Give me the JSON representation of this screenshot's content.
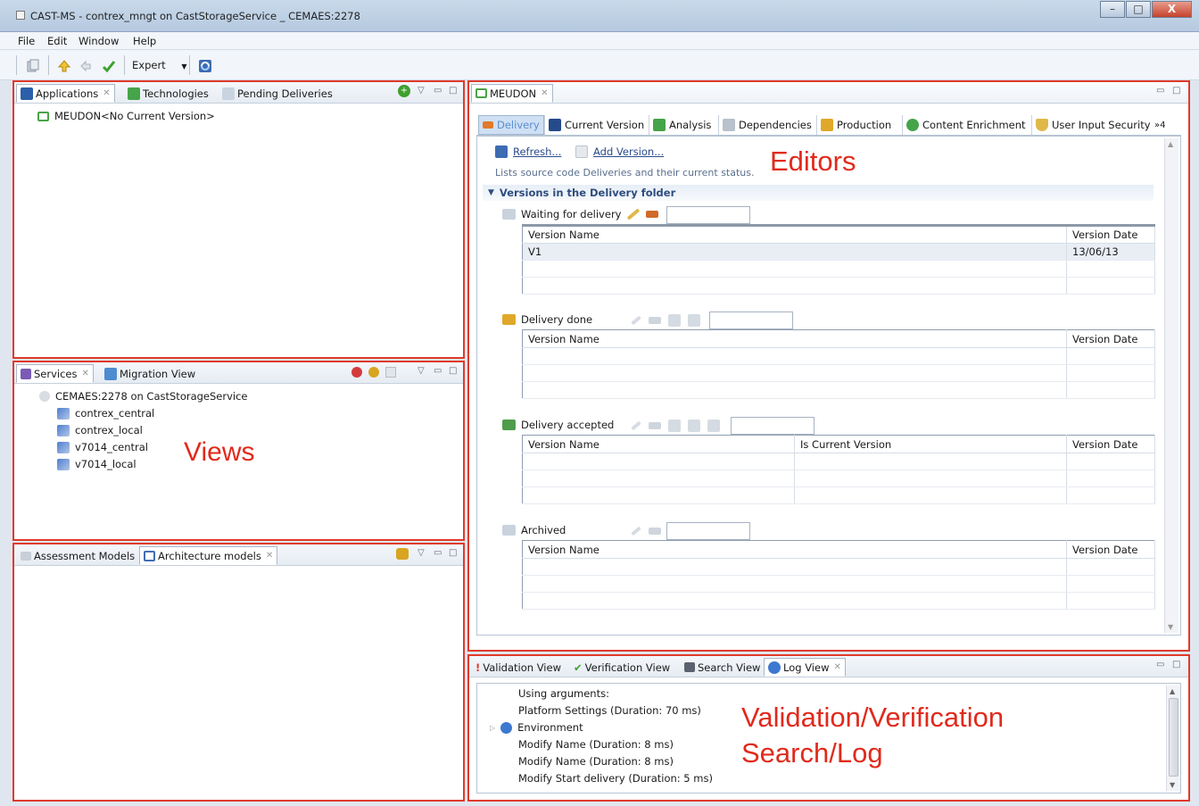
{
  "window": {
    "title": "CAST-MS - contrex_mngt on CastStorageService _ CEMAES:2278",
    "minimize": "–",
    "maximize": "□",
    "close": "X"
  },
  "menu": [
    "File",
    "Edit",
    "Window",
    "Help"
  ],
  "toolbar": {
    "mode": "Expert"
  },
  "top_left_panel": {
    "tabs": [
      {
        "label": "Applications",
        "icon": "application-icon"
      },
      {
        "label": "Technologies",
        "icon": "technology-icon"
      },
      {
        "label": "Pending Deliveries",
        "icon": "pending-deliveries-icon"
      }
    ],
    "tree": [
      {
        "label": "MEUDON<No Current Version>",
        "icon": "application-folder-icon"
      }
    ]
  },
  "mid_left_panel": {
    "tabs": [
      {
        "label": "Services",
        "icon": "services-icon"
      },
      {
        "label": "Migration View",
        "icon": "migration-icon"
      }
    ],
    "tree_root": "CEMAES:2278 on CastStorageService",
    "tree_children": [
      "contrex_central",
      "contrex_local",
      "v7014_central",
      "v7014_local"
    ]
  },
  "bottom_left_panel": {
    "tabs": [
      {
        "label": "Assessment Models",
        "icon": "assessment-icon"
      },
      {
        "label": "Architecture models",
        "icon": "architecture-icon"
      }
    ]
  },
  "overlays": {
    "views": "Views",
    "editors": "Editors",
    "validation_line1": "Validation/Verification",
    "validation_line2": "Search/Log"
  },
  "editor": {
    "tab": "MEUDON",
    "subtabs": [
      "Delivery",
      "Current Version",
      "Analysis",
      "Dependencies",
      "Production",
      "Content Enrichment",
      "User Input Security"
    ],
    "overflow": "»4",
    "refresh": "Refresh...",
    "add_version": "Add Version...",
    "description": "Lists source code Deliveries and their current status.",
    "section": "Versions in the Delivery folder",
    "groups": {
      "waiting": {
        "label": "Waiting for delivery",
        "columns": [
          "Version Name",
          "Version Date"
        ],
        "rows": [
          [
            "V1",
            "13/06/13"
          ]
        ]
      },
      "done": {
        "label": "Delivery done",
        "columns": [
          "Version Name",
          "Version Date"
        ]
      },
      "accepted": {
        "label": "Delivery accepted",
        "columns": [
          "Version Name",
          "Is Current Version",
          "Version Date"
        ]
      },
      "archived": {
        "label": "Archived",
        "columns": [
          "Version Name",
          "Version Date"
        ]
      }
    }
  },
  "bottom_panel": {
    "tabs": [
      {
        "label": "Validation View",
        "icon": "validation-icon"
      },
      {
        "label": "Verification View",
        "icon": "verification-icon"
      },
      {
        "label": "Search View",
        "icon": "search-icon"
      },
      {
        "label": "Log View",
        "icon": "info-icon"
      }
    ],
    "log": [
      "Using arguments:",
      "Platform Settings (Duration: 70 ms)",
      "Environment",
      "Modify Name (Duration: 8 ms)",
      "Modify Name (Duration: 8 ms)",
      "Modify Start delivery (Duration: 5 ms)"
    ]
  },
  "colors": {
    "highlight": "#e03a2c",
    "label_red": "#e02a1c"
  }
}
